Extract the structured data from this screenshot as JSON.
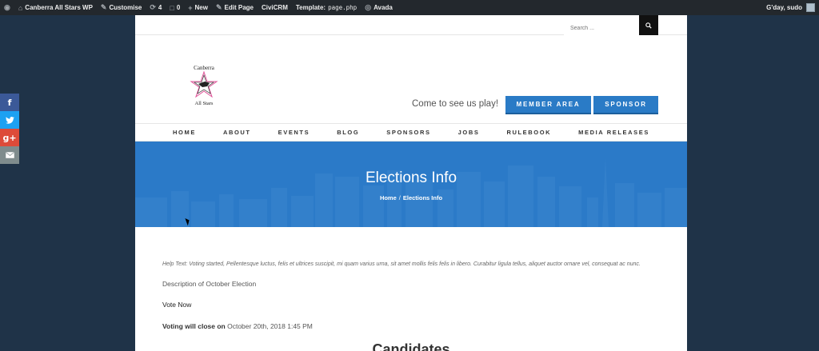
{
  "adminbar": {
    "site_name": "Canberra All Stars WP",
    "customise": "Customise",
    "updates": "4",
    "comments": "0",
    "new": "New",
    "edit_page": "Edit Page",
    "civicrm": "CiviCRM",
    "template_label": "Template:",
    "template_file": "page.php",
    "avada": "Avada",
    "greeting": "G'day, sudo"
  },
  "social": {
    "google": "g+"
  },
  "search": {
    "placeholder": "Search ..."
  },
  "header": {
    "logo_top": "Canberra",
    "logo_bottom": "All Stars",
    "tagline": "Come to see us play!",
    "member_button": "MEMBER AREA",
    "sponsor_button": "SPONSOR"
  },
  "nav": {
    "items": [
      "HOME",
      "ABOUT",
      "EVENTS",
      "BLOG",
      "SPONSORS",
      "JOBS",
      "RULEBOOK",
      "MEDIA RELEASES"
    ]
  },
  "banner": {
    "title": "Elections Info",
    "crumb_home": "Home",
    "crumb_sep": "/",
    "crumb_current": "Elections Info"
  },
  "content": {
    "help_text": "Help Text: Voting started, Pellentesque luctus, felis et ultrices suscipit, mi quam varius urna, sit amet mollis felis felis in libero. Curabitur ligula tellus, aliquet auctor ornare vel, consequat ac nunc.",
    "description": "Description of October Election",
    "vote_now": "Vote Now",
    "close_label": "Voting will close on",
    "close_date": "October 20th, 2018 1:45 PM",
    "candidates_heading": "Candidates"
  },
  "colors": {
    "accent": "#2a7bc6",
    "adminbar": "#23282d",
    "background": "#1f3348"
  }
}
